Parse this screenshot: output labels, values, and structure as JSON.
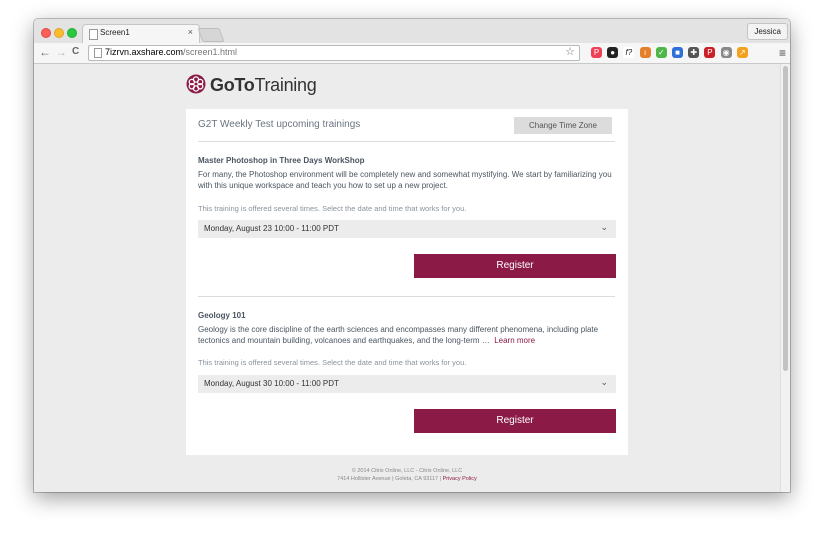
{
  "browser": {
    "tab_title": "Screen1",
    "tab_close": "×",
    "user": "Jessica",
    "url_host": "7izrvn.axshare.com",
    "url_path": "/screen1.html",
    "back": "←",
    "forward": "→",
    "reload": "C",
    "star": "☆",
    "menu": "≡",
    "extensions": [
      {
        "name": "pocket-icon",
        "color": "#ef4056",
        "glyph": "P"
      },
      {
        "name": "camera-icon",
        "color": "#222222",
        "glyph": "●"
      },
      {
        "name": "fx-icon",
        "color": "#ffffff",
        "glyph": "f?"
      },
      {
        "name": "bar-icon",
        "color": "#e47f2a",
        "glyph": "ı"
      },
      {
        "name": "evernote-icon",
        "color": "#4fb648",
        "glyph": "✓"
      },
      {
        "name": "folder-icon",
        "color": "#2f6fdb",
        "glyph": "■"
      },
      {
        "name": "puzzle-icon",
        "color": "#555555",
        "glyph": "✚"
      },
      {
        "name": "pinterest-icon",
        "color": "#cb2027",
        "glyph": "P"
      },
      {
        "name": "eye-icon",
        "color": "#888888",
        "glyph": "◉"
      },
      {
        "name": "analytics-icon",
        "color": "#f4a21e",
        "glyph": "↗"
      }
    ]
  },
  "brand": {
    "logo_bold": "GoTo",
    "logo_rest": "Training",
    "accent": "#8b1a47"
  },
  "page": {
    "heading": "G2T Weekly Test upcoming trainings",
    "tz_button": "Change Time Zone",
    "trainings": [
      {
        "title": "Master Photoshop in Three Days WorkShop",
        "description": "For many, the Photoshop environment will be completely new and somewhat mystifying. We start by familiarizing you with this unique workspace and teach you how to set up a new project.",
        "learn_more": "",
        "note": "This training is offered several times. Select the date and time that works for you.",
        "session": "Monday, August 23 10:00 - 11:00 PDT",
        "register": "Register"
      },
      {
        "title": "Geology 101",
        "description": "Geology is the core discipline of the earth sciences and encompasses many different phenomena, including plate tectonics and mountain building, volcanoes and earthquakes, and the long-term …",
        "learn_more": "Learn more",
        "note": "This training is offered several times. Select the date and time that works for you.",
        "session": "Monday, August 30 10:00 - 11:00 PDT",
        "register": "Register"
      }
    ]
  },
  "footer": {
    "line1": "© 2014 Citrix Online, LLC - Citrix Online, LLC",
    "line2": "7414 Hollister Avenue | Goleta, CA 93117 |",
    "privacy": "Privacy Policy"
  }
}
